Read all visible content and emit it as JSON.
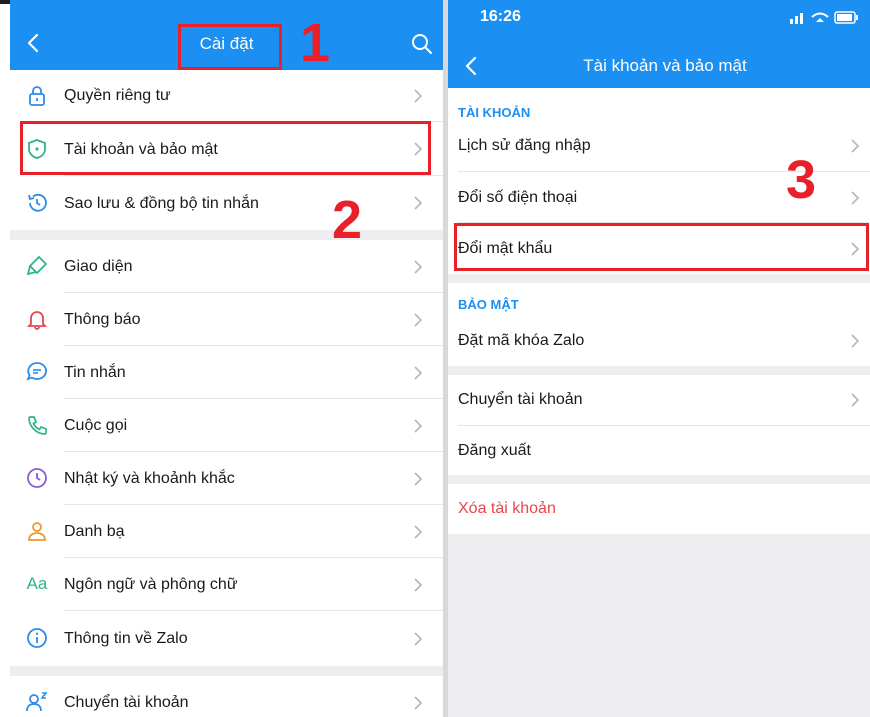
{
  "left": {
    "title": "Cài đặt",
    "items": [
      {
        "label": "Quyền riêng tư",
        "icon": "lock-icon",
        "color": "#2b8de8"
      },
      {
        "label": "Tài khoản và bảo mật",
        "icon": "shield-icon",
        "color": "#2fb38a"
      },
      {
        "label": "Sao lưu & đồng bộ tin nhắn",
        "icon": "history-icon",
        "color": "#2b8de8"
      },
      {
        "label": "Giao diện",
        "icon": "paintbrush-icon",
        "color": "#2fb38a"
      },
      {
        "label": "Thông báo",
        "icon": "bell-icon",
        "color": "#e8454f"
      },
      {
        "label": "Tin nhắn",
        "icon": "chat-bubble-icon",
        "color": "#2b8de8"
      },
      {
        "label": "Cuộc gọi",
        "icon": "phone-icon",
        "color": "#2fb38a"
      },
      {
        "label": "Nhật ký và khoảnh khắc",
        "icon": "clock-icon",
        "color": "#8a5cd6"
      },
      {
        "label": "Danh bạ",
        "icon": "person-icon",
        "color": "#f0982a"
      },
      {
        "label": "Ngôn ngữ và phông chữ",
        "icon": "font-icon",
        "color": "#2fb38a"
      },
      {
        "label": "Thông tin về Zalo",
        "icon": "info-icon",
        "color": "#2b8de8"
      },
      {
        "label": "Chuyển tài khoản",
        "icon": "switch-account-icon",
        "color": "#2b8de8"
      }
    ]
  },
  "right": {
    "time": "16:26",
    "title": "Tài khoản và bảo mật",
    "section_account": "TÀI KHOẢN",
    "account_items": [
      "Lịch sử đăng nhập",
      "Đổi số điện thoại",
      "Đổi mật khẩu"
    ],
    "section_security": "BẢO MẬT",
    "security_items": [
      "Đặt mã khóa Zalo"
    ],
    "switch_account": "Chuyển tài khoản",
    "logout": "Đăng xuất",
    "delete_account": "Xóa tài khoản",
    "delete_color": "#e8454f"
  },
  "annotations": {
    "step1": "1",
    "step2": "2",
    "step3": "3"
  },
  "colors": {
    "brand": "#1c8ff2",
    "annotation": "#e8202a"
  }
}
